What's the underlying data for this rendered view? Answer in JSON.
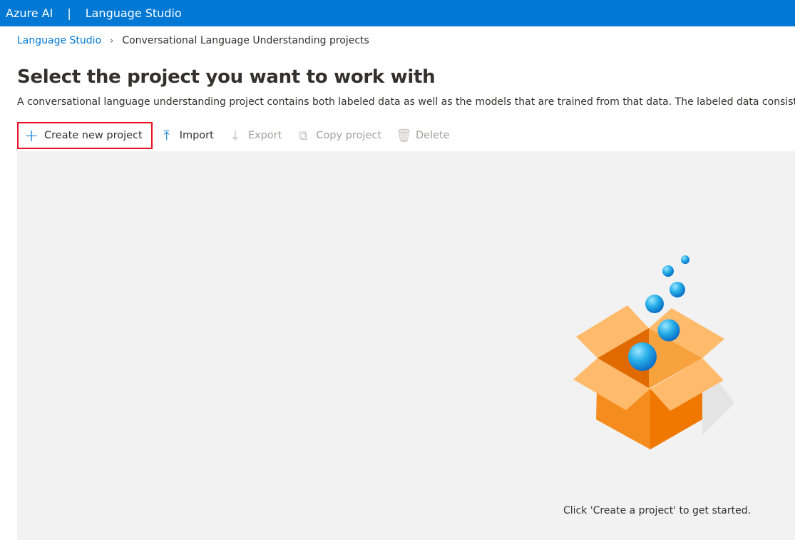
{
  "header": {
    "brand": "Azure AI",
    "separator": "|",
    "app": "Language Studio"
  },
  "breadcrumb": {
    "root": "Language Studio",
    "current": "Conversational Language Understanding projects"
  },
  "page": {
    "title": "Select the project you want to work with",
    "description": "A conversational language understanding project contains both labeled data as well as the models that are trained from that data. The labeled data consists o"
  },
  "toolbar": {
    "create": "Create new project",
    "import": "Import",
    "export": "Export",
    "copy": "Copy project",
    "delete": "Delete"
  },
  "empty_state": {
    "message": "Click 'Create a project' to get started."
  },
  "colors": {
    "accent": "#0078d4",
    "highlight": "#e81123"
  }
}
